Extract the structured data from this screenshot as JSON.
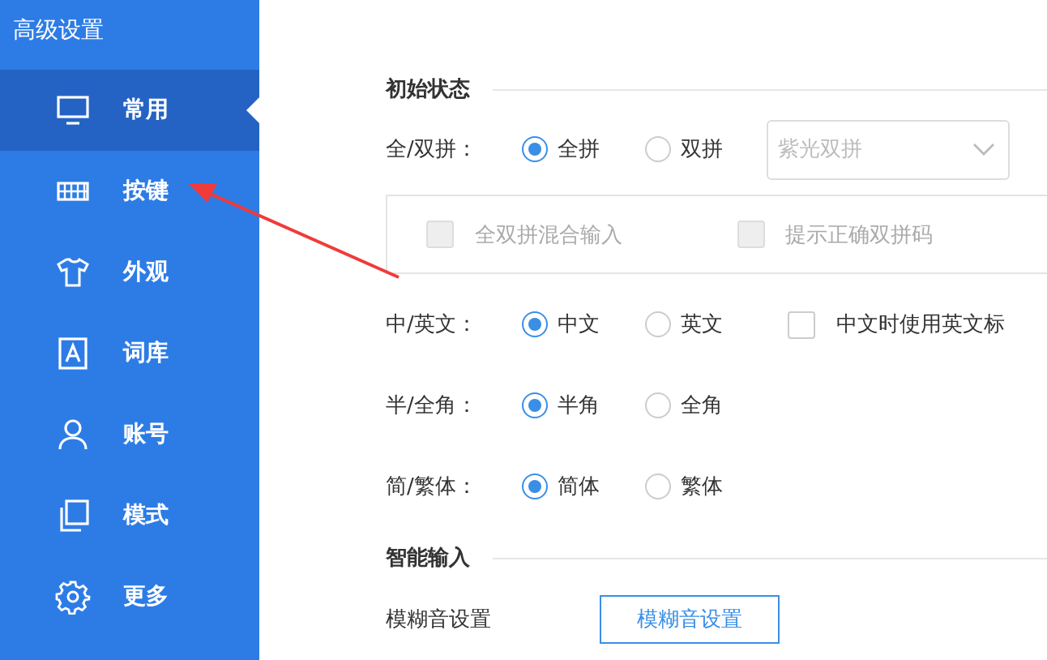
{
  "window": {
    "title": "高级设置"
  },
  "sidebar": {
    "items": [
      {
        "label": "常用",
        "selected": true
      },
      {
        "label": "按键",
        "selected": false
      },
      {
        "label": "外观",
        "selected": false
      },
      {
        "label": "词库",
        "selected": false
      },
      {
        "label": "账号",
        "selected": false
      },
      {
        "label": "模式",
        "selected": false
      },
      {
        "label": "更多",
        "selected": false
      }
    ]
  },
  "sections": [
    {
      "title": "初始状态",
      "rows": [
        {
          "kind": "radio",
          "label": "全/双拼：",
          "options": [
            {
              "label": "全拼",
              "selected": true
            },
            {
              "label": "双拼",
              "selected": false
            }
          ],
          "dropdown": {
            "value": "紫光双拼",
            "disabled": true
          }
        },
        {
          "kind": "checkbox-group",
          "disabled": true,
          "items": [
            {
              "label": "全双拼混合输入",
              "checked": false
            },
            {
              "label": "提示正确双拼码",
              "checked": false
            }
          ]
        },
        {
          "kind": "radio",
          "label": "中/英文：",
          "options": [
            {
              "label": "中文",
              "selected": true
            },
            {
              "label": "英文",
              "selected": false
            }
          ],
          "checkbox": {
            "label": "中文时使用英文标",
            "checked": false
          }
        },
        {
          "kind": "radio",
          "label": "半/全角：",
          "options": [
            {
              "label": "半角",
              "selected": true
            },
            {
              "label": "全角",
              "selected": false
            }
          ]
        },
        {
          "kind": "radio",
          "label": "简/繁体：",
          "options": [
            {
              "label": "简体",
              "selected": true
            },
            {
              "label": "繁体",
              "selected": false
            }
          ]
        }
      ]
    },
    {
      "title": "智能输入",
      "rows": [
        {
          "kind": "button",
          "label": "模糊音设置",
          "button": "模糊音设置"
        }
      ]
    }
  ]
}
